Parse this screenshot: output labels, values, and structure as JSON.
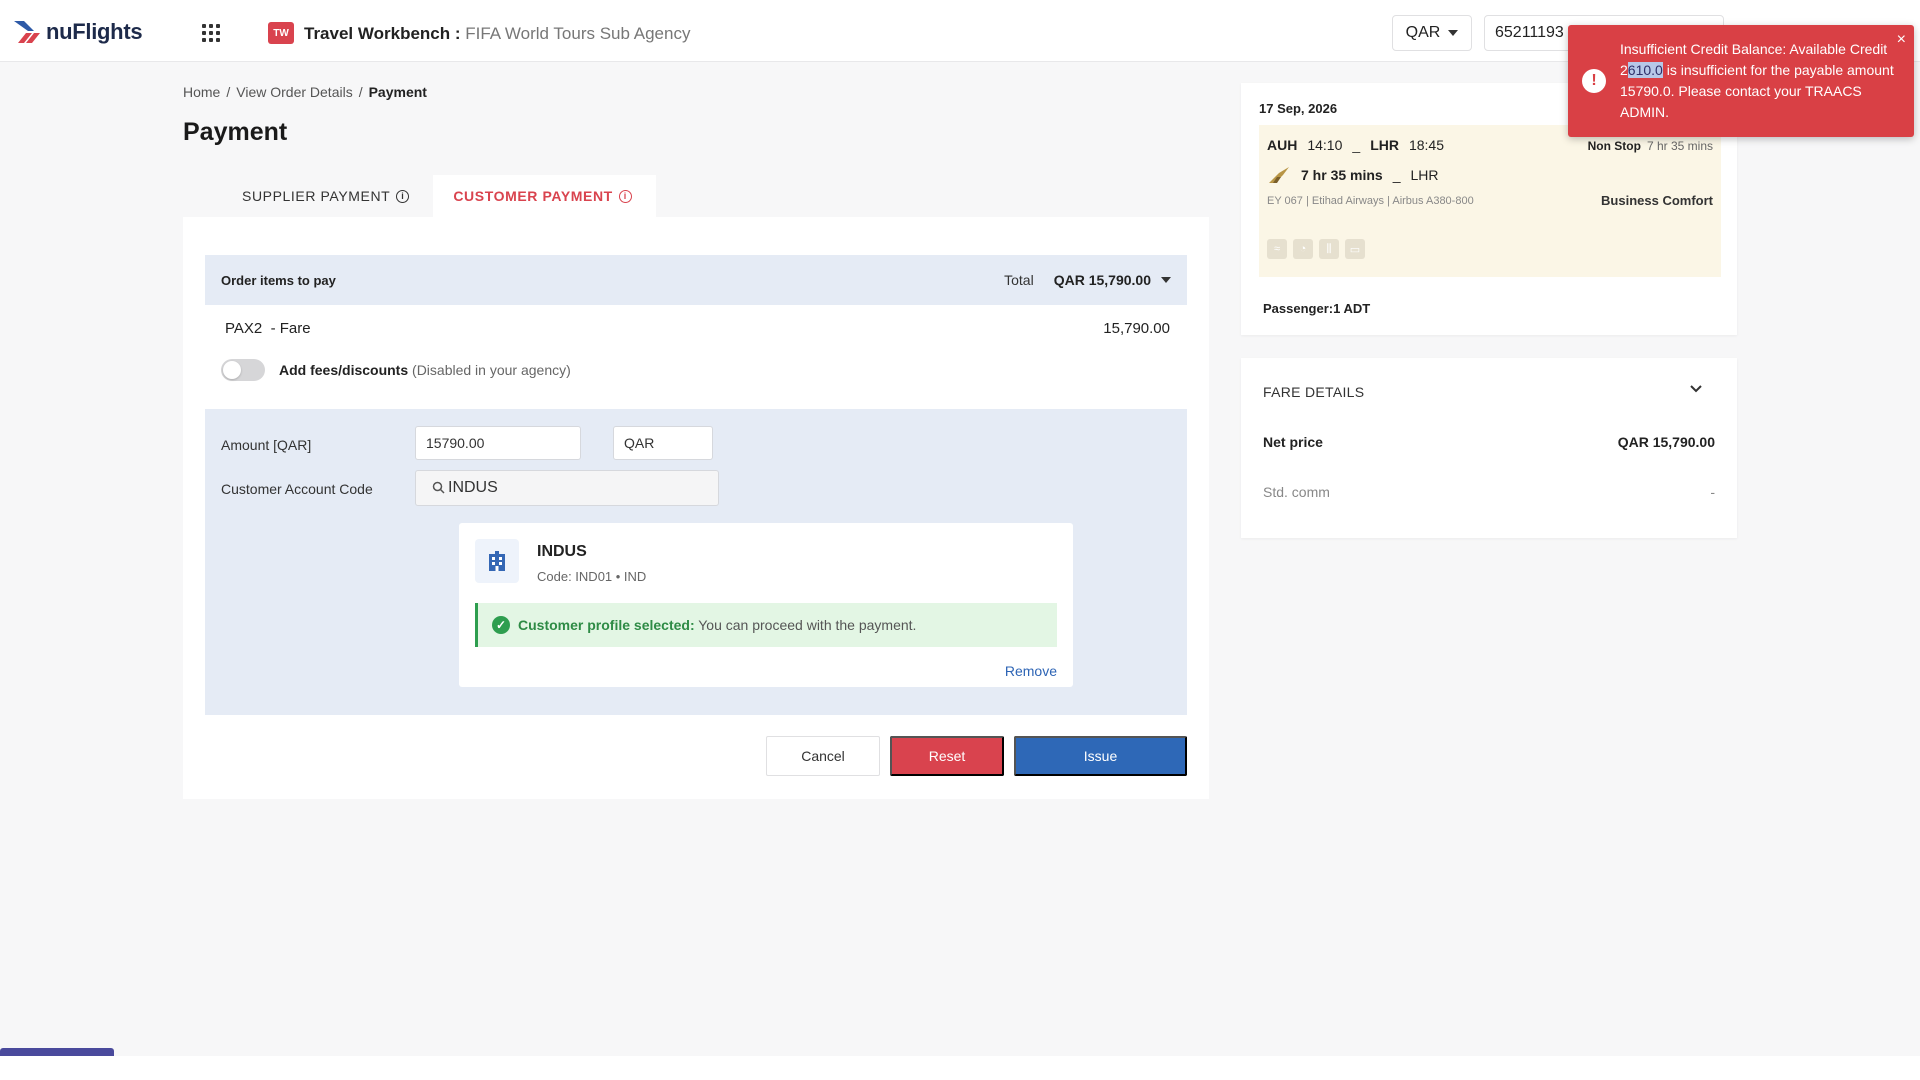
{
  "header": {
    "logo_text": "nuFlights",
    "workbench_icon_text": "TW",
    "workbench_title": "Travel Workbench",
    "workbench_separator": " : ",
    "agency_name": "FIFA World Tours Sub Agency",
    "currency": "QAR",
    "account_number": "65211193"
  },
  "breadcrumb": {
    "items": [
      "Home",
      "View Order Details",
      "Payment"
    ],
    "separator": "/"
  },
  "page_title": "Payment",
  "tabs": [
    {
      "label": "SUPPLIER PAYMENT",
      "active": false
    },
    {
      "label": "CUSTOMER PAYMENT",
      "active": true
    }
  ],
  "order": {
    "header_label": "Order items to pay",
    "total_label": "Total",
    "total_value": "QAR 15,790.00",
    "pax_label": "PAX2",
    "pax_type": "- Fare",
    "pax_amount": "15,790.00",
    "fees_toggle_label": "Add fees/discounts",
    "fees_toggle_note": "(Disabled in your agency)",
    "fees_enabled": false
  },
  "payment_form": {
    "amount_label": "Amount [QAR]",
    "amount_value": "15790.00",
    "currency_value": "QAR",
    "account_code_label": "Customer Account Code",
    "account_search_value": "INDUS"
  },
  "customer": {
    "name": "INDUS",
    "code_line": "Code: IND01 • IND",
    "success_title": "Customer profile selected:",
    "success_message": "You can proceed with the payment.",
    "remove_label": "Remove"
  },
  "actions": {
    "cancel": "Cancel",
    "reset": "Reset",
    "issue": "Issue"
  },
  "flight": {
    "date": "17 Sep, 2026",
    "origin": "AUH",
    "departure_time": "14:10",
    "destination": "LHR",
    "arrival_time": "18:45",
    "stops": "Non Stop",
    "stops_duration": "7 hr 35 mins",
    "duration": "7 hr 35 mins",
    "duration_dest": "LHR",
    "flight_info": "EY 067 | Etihad Airways | Airbus A380-800",
    "cabin_class": "Business Comfort",
    "passenger": "Passenger:1 ADT"
  },
  "fare": {
    "title": "FARE DETAILS",
    "net_price_label": "Net price",
    "net_price_value": "QAR 15,790.00",
    "std_comm_label": "Std. comm",
    "std_comm_value": "-"
  },
  "toast": {
    "line_part1": "Insufficient Credit Balance: Available Credit 2",
    "highlight": "610.0",
    "line_part2": " is insufficient for the payable amount 15790.0. Please contact your TRAACS ADMIN.",
    "close_symbol": "×"
  },
  "colors": {
    "brand_red": "#d9434e",
    "primary_blue": "#2e68b7",
    "success_green": "#2e9e4f",
    "form_bg": "#e5ebf5",
    "toast_bg": "#d94045"
  }
}
